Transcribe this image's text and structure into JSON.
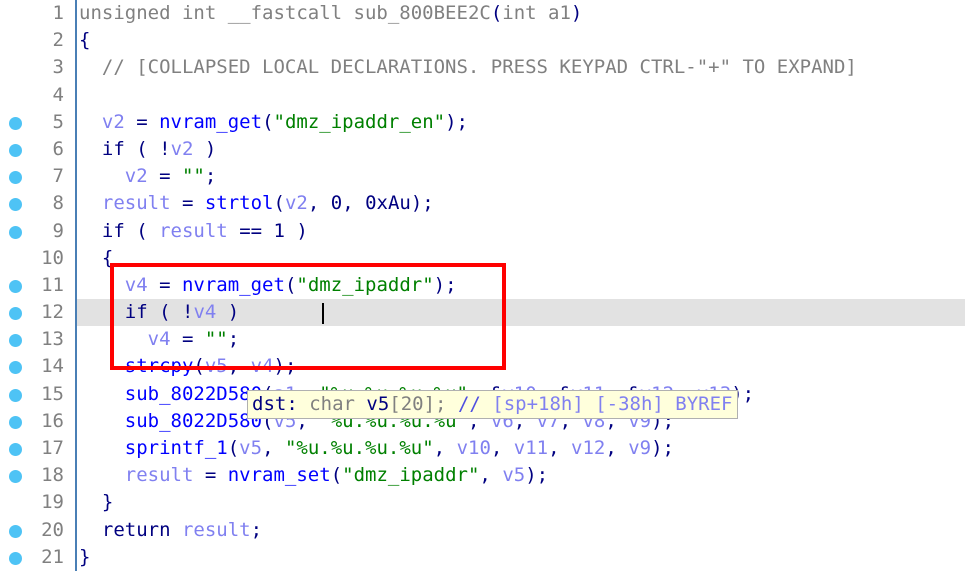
{
  "editor": {
    "name": "hex-rays-decompiler-pseudocode",
    "lines": [
      {
        "n": "1",
        "breakpoint": false,
        "highlight": false,
        "tokens": [
          {
            "t": "unsigned int ",
            "c": "gray"
          },
          {
            "t": "__fastcall",
            "c": "gray"
          },
          {
            "t": " sub_800BEE2C",
            "c": "gray"
          },
          {
            "t": "(",
            "c": "punc"
          },
          {
            "t": "int a1",
            "c": "gray"
          },
          {
            "t": ")",
            "c": "punc"
          }
        ]
      },
      {
        "n": "2",
        "breakpoint": false,
        "highlight": false,
        "tokens": [
          {
            "t": "{",
            "c": "punc"
          }
        ]
      },
      {
        "n": "3",
        "breakpoint": false,
        "highlight": false,
        "tokens": [
          {
            "t": "  // [COLLAPSED LOCAL DECLARATIONS. PRESS KEYPAD CTRL-\"+\" TO EXPAND]",
            "c": "cmt"
          }
        ]
      },
      {
        "n": "4",
        "breakpoint": false,
        "highlight": false,
        "tokens": []
      },
      {
        "n": "5",
        "breakpoint": true,
        "highlight": false,
        "tokens": [
          {
            "t": "  ",
            "c": "plain"
          },
          {
            "t": "v2",
            "c": "var"
          },
          {
            "t": " = ",
            "c": "plain"
          },
          {
            "t": "nvram_get",
            "c": "fn"
          },
          {
            "t": "(",
            "c": "punc"
          },
          {
            "t": "\"dmz_ipaddr_en\"",
            "c": "str"
          },
          {
            "t": ");",
            "c": "punc"
          }
        ]
      },
      {
        "n": "6",
        "breakpoint": true,
        "highlight": false,
        "tokens": [
          {
            "t": "  ",
            "c": "plain"
          },
          {
            "t": "if",
            "c": "kw"
          },
          {
            "t": " ( ",
            "c": "punc"
          },
          {
            "t": "!",
            "c": "punc"
          },
          {
            "t": "v2",
            "c": "var"
          },
          {
            "t": " )",
            "c": "punc"
          }
        ]
      },
      {
        "n": "7",
        "breakpoint": true,
        "highlight": false,
        "tokens": [
          {
            "t": "    ",
            "c": "plain"
          },
          {
            "t": "v2",
            "c": "var"
          },
          {
            "t": " = ",
            "c": "plain"
          },
          {
            "t": "\"\"",
            "c": "str"
          },
          {
            "t": ";",
            "c": "punc"
          }
        ]
      },
      {
        "n": "8",
        "breakpoint": true,
        "highlight": false,
        "tokens": [
          {
            "t": "  ",
            "c": "plain"
          },
          {
            "t": "result",
            "c": "var"
          },
          {
            "t": " = ",
            "c": "plain"
          },
          {
            "t": "strtol",
            "c": "fn"
          },
          {
            "t": "(",
            "c": "punc"
          },
          {
            "t": "v2",
            "c": "var"
          },
          {
            "t": ", ",
            "c": "punc"
          },
          {
            "t": "0",
            "c": "num"
          },
          {
            "t": ", ",
            "c": "punc"
          },
          {
            "t": "0xAu",
            "c": "num"
          },
          {
            "t": ");",
            "c": "punc"
          }
        ]
      },
      {
        "n": "9",
        "breakpoint": true,
        "highlight": false,
        "tokens": [
          {
            "t": "  ",
            "c": "plain"
          },
          {
            "t": "if",
            "c": "kw"
          },
          {
            "t": " ( ",
            "c": "punc"
          },
          {
            "t": "result",
            "c": "var"
          },
          {
            "t": " == ",
            "c": "punc"
          },
          {
            "t": "1",
            "c": "num"
          },
          {
            "t": " )",
            "c": "punc"
          }
        ]
      },
      {
        "n": "10",
        "breakpoint": false,
        "highlight": false,
        "tokens": [
          {
            "t": "  {",
            "c": "punc"
          }
        ]
      },
      {
        "n": "11",
        "breakpoint": true,
        "highlight": false,
        "tokens": [
          {
            "t": "    ",
            "c": "plain"
          },
          {
            "t": "v4",
            "c": "var"
          },
          {
            "t": " = ",
            "c": "plain"
          },
          {
            "t": "nvram_get",
            "c": "fn"
          },
          {
            "t": "(",
            "c": "punc"
          },
          {
            "t": "\"dmz_ipaddr\"",
            "c": "str"
          },
          {
            "t": ");",
            "c": "punc"
          }
        ]
      },
      {
        "n": "12",
        "breakpoint": true,
        "highlight": true,
        "tokens": [
          {
            "t": "    ",
            "c": "plain"
          },
          {
            "t": "if",
            "c": "kw"
          },
          {
            "t": " ( ",
            "c": "punc"
          },
          {
            "t": "!",
            "c": "punc"
          },
          {
            "t": "v4",
            "c": "var"
          },
          {
            "t": " )",
            "c": "punc"
          }
        ]
      },
      {
        "n": "13",
        "breakpoint": true,
        "highlight": false,
        "tokens": [
          {
            "t": "      ",
            "c": "plain"
          },
          {
            "t": "v4",
            "c": "var"
          },
          {
            "t": " = ",
            "c": "plain"
          },
          {
            "t": "\"\"",
            "c": "str"
          },
          {
            "t": ";",
            "c": "punc"
          }
        ]
      },
      {
        "n": "14",
        "breakpoint": true,
        "highlight": false,
        "tokens": [
          {
            "t": "    ",
            "c": "plain"
          },
          {
            "t": "strcpy",
            "c": "fn"
          },
          {
            "t": "(",
            "c": "punc"
          },
          {
            "t": "v5",
            "c": "var"
          },
          {
            "t": ", ",
            "c": "punc"
          },
          {
            "t": "v4",
            "c": "var"
          },
          {
            "t": ");",
            "c": "punc"
          }
        ]
      },
      {
        "n": "15",
        "breakpoint": true,
        "highlight": false,
        "tokens": [
          {
            "t": "    ",
            "c": "plain"
          },
          {
            "t": "sub_8022D580",
            "c": "fn"
          },
          {
            "t": "(",
            "c": "punc"
          },
          {
            "t": "a1",
            "c": "var"
          },
          {
            "t": ", ",
            "c": "punc"
          },
          {
            "t": "\"%u.%u.%u.%u\"",
            "c": "str"
          },
          {
            "t": ", ",
            "c": "punc"
          },
          {
            "t": "&",
            "c": "punc"
          },
          {
            "t": "v10",
            "c": "var"
          },
          {
            "t": ", ",
            "c": "punc"
          },
          {
            "t": "&",
            "c": "punc"
          },
          {
            "t": "v11",
            "c": "var"
          },
          {
            "t": ", ",
            "c": "punc"
          },
          {
            "t": "&",
            "c": "punc"
          },
          {
            "t": "v12",
            "c": "var"
          },
          {
            "t": ", ",
            "c": "punc"
          },
          {
            "t": "v13",
            "c": "var"
          },
          {
            "t": ");",
            "c": "punc"
          }
        ]
      },
      {
        "n": "16",
        "breakpoint": true,
        "highlight": false,
        "tokens": [
          {
            "t": "    ",
            "c": "plain"
          },
          {
            "t": "sub_8022D5",
            "c": "fn"
          },
          {
            "t": "80",
            "c": "fn"
          },
          {
            "t": "(",
            "c": "punc"
          },
          {
            "t": "v5",
            "c": "var"
          },
          {
            "t": ", ",
            "c": "punc"
          },
          {
            "t": "\"%u.%u.%u.%u\"",
            "c": "str"
          },
          {
            "t": ", ",
            "c": "punc"
          },
          {
            "t": "v6",
            "c": "var"
          },
          {
            "t": ", ",
            "c": "punc"
          },
          {
            "t": "v7",
            "c": "var"
          },
          {
            "t": ", ",
            "c": "punc"
          },
          {
            "t": "v8",
            "c": "var"
          },
          {
            "t": ", ",
            "c": "punc"
          },
          {
            "t": "v9",
            "c": "var"
          },
          {
            "t": ");",
            "c": "punc"
          }
        ]
      },
      {
        "n": "17",
        "breakpoint": true,
        "highlight": false,
        "tokens": [
          {
            "t": "    ",
            "c": "plain"
          },
          {
            "t": "sprintf_1",
            "c": "fn"
          },
          {
            "t": "(",
            "c": "punc"
          },
          {
            "t": "v5",
            "c": "var"
          },
          {
            "t": ", ",
            "c": "punc"
          },
          {
            "t": "\"%u.%u.%u.%u\"",
            "c": "str"
          },
          {
            "t": ", ",
            "c": "punc"
          },
          {
            "t": "v10",
            "c": "var"
          },
          {
            "t": ", ",
            "c": "punc"
          },
          {
            "t": "v11",
            "c": "var"
          },
          {
            "t": ", ",
            "c": "punc"
          },
          {
            "t": "v12",
            "c": "var"
          },
          {
            "t": ", ",
            "c": "punc"
          },
          {
            "t": "v9",
            "c": "var"
          },
          {
            "t": ");",
            "c": "punc"
          }
        ]
      },
      {
        "n": "18",
        "breakpoint": true,
        "highlight": false,
        "tokens": [
          {
            "t": "    ",
            "c": "plain"
          },
          {
            "t": "result",
            "c": "var"
          },
          {
            "t": " = ",
            "c": "plain"
          },
          {
            "t": "nvram_set",
            "c": "fn"
          },
          {
            "t": "(",
            "c": "punc"
          },
          {
            "t": "\"dmz_ipaddr\"",
            "c": "str"
          },
          {
            "t": ", ",
            "c": "punc"
          },
          {
            "t": "v5",
            "c": "var"
          },
          {
            "t": ");",
            "c": "punc"
          }
        ]
      },
      {
        "n": "19",
        "breakpoint": false,
        "highlight": false,
        "tokens": [
          {
            "t": "  }",
            "c": "punc"
          }
        ]
      },
      {
        "n": "20",
        "breakpoint": true,
        "highlight": false,
        "tokens": [
          {
            "t": "  ",
            "c": "plain"
          },
          {
            "t": "return",
            "c": "kw"
          },
          {
            "t": " ",
            "c": "plain"
          },
          {
            "t": "result",
            "c": "var"
          },
          {
            "t": ";",
            "c": "punc"
          }
        ]
      },
      {
        "n": "21",
        "breakpoint": true,
        "highlight": false,
        "tokens": [
          {
            "t": "}",
            "c": "punc"
          }
        ]
      }
    ]
  },
  "annotation": {
    "red_box_color": "#ff0000",
    "covers_lines": "11-14"
  },
  "cursor": {
    "line": "12",
    "color": "#000000"
  },
  "tooltip": {
    "name_label": "dst:",
    "type_text": " char ",
    "var_text": "v5",
    "bracket_text": "[20];",
    "slash_text": " //",
    "comment_text": " [sp+18h] [-38h] BYREF",
    "background": "#ffffdc"
  },
  "colors": {
    "breakpoint": "#4ec3f5",
    "line_number": "#808080",
    "cursor_line_bg": "#e2e2e2",
    "separator": "#4a7fb5",
    "string": "#008000",
    "function": "#0000ff",
    "variable": "#8080f0",
    "comment": "#808080"
  }
}
